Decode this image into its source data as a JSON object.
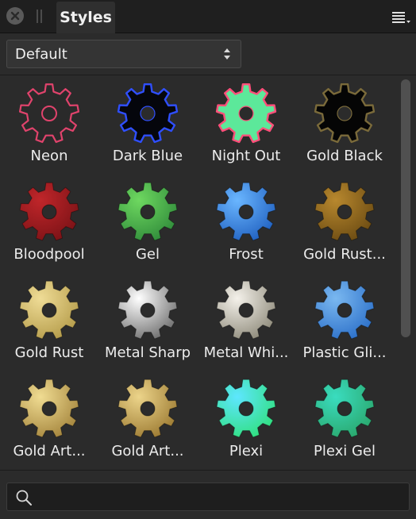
{
  "panel": {
    "tab_label": "Styles",
    "preset": "Default"
  },
  "search": {
    "placeholder": ""
  },
  "styles": [
    {
      "label": "Neon",
      "icon": "gear-icon",
      "style": "neon",
      "colors": [
        "#2a2a2a",
        "#e0436c"
      ]
    },
    {
      "label": "Dark Blue",
      "icon": "gear-icon",
      "style": "glow",
      "colors": [
        "#05060c",
        "#2f4fff"
      ]
    },
    {
      "label": "Night Out",
      "icon": "gear-icon",
      "style": "glow",
      "colors": [
        "#5ce89a",
        "#ff4f7a"
      ]
    },
    {
      "label": "Gold Black",
      "icon": "gear-icon",
      "style": "glow",
      "colors": [
        "#050505",
        "#7a6a3a"
      ]
    },
    {
      "label": "Bloodpool",
      "icon": "gear-icon",
      "style": "solid",
      "colors": [
        "#c0262a",
        "#7a1216"
      ]
    },
    {
      "label": "Gel",
      "icon": "gear-icon",
      "style": "solid",
      "colors": [
        "#6ed860",
        "#2f8a3a"
      ]
    },
    {
      "label": "Frost",
      "icon": "gear-icon",
      "style": "solid",
      "colors": [
        "#6ab6ff",
        "#1f5fbf"
      ]
    },
    {
      "label": "Gold Rust...",
      "icon": "gear-icon",
      "style": "solid",
      "colors": [
        "#b8882e",
        "#6a4a12"
      ]
    },
    {
      "label": "Gold Rust",
      "icon": "gear-icon",
      "style": "solid",
      "colors": [
        "#efdc96",
        "#b39a48"
      ]
    },
    {
      "label": "Metal Sharp",
      "icon": "gear-icon",
      "style": "solid",
      "colors": [
        "#ffffff",
        "#6a6a6a"
      ]
    },
    {
      "label": "Metal Whi...",
      "icon": "gear-icon",
      "style": "solid",
      "colors": [
        "#f4f1ea",
        "#8c8878"
      ]
    },
    {
      "label": "Plastic Gli...",
      "icon": "gear-icon",
      "style": "solid",
      "colors": [
        "#7ab8f0",
        "#2a6ec8"
      ]
    },
    {
      "label": "Gold Art...",
      "icon": "gear-icon",
      "style": "solid",
      "colors": [
        "#f0dc92",
        "#a2823a"
      ]
    },
    {
      "label": "Gold Art...",
      "icon": "gear-icon",
      "style": "solid",
      "colors": [
        "#ecd48a",
        "#9a7830"
      ]
    },
    {
      "label": "Plexi",
      "icon": "gear-icon",
      "style": "solid",
      "colors": [
        "#5ee6ff",
        "#2fe07a"
      ]
    },
    {
      "label": "Plexi Gel",
      "icon": "gear-icon",
      "style": "solid",
      "colors": [
        "#3adcbf",
        "#2aa66a"
      ]
    }
  ]
}
